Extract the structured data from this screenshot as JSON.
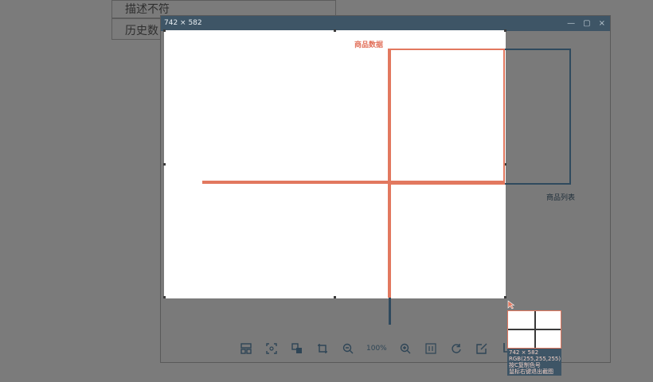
{
  "background": {
    "line1": "描述不符",
    "line2": "历史数"
  },
  "window": {
    "dim_label": "742 × 582",
    "controls": [
      "—",
      "▢",
      "×"
    ]
  },
  "overlay": {
    "title": "商品数据",
    "caption": "商品列表"
  },
  "toolbar": {
    "zoom": "100%",
    "buttons": [
      "layout-icon",
      "fit-icon",
      "copy-icon",
      "crop-icon",
      "zoom-out-icon",
      "zoom-in-icon",
      "original-size-icon",
      "rotate-icon",
      "edit-icon",
      "crop-corner-icon"
    ]
  },
  "info": {
    "size": "742 × 582",
    "rgb": "RGB(255,255,255)",
    "line3": "按C复制色号",
    "line4": "鼠标右键退出截图"
  },
  "colors": {
    "accent": "#e2785f",
    "dark": "#2f4a5e",
    "titlebar": "#3e5566"
  }
}
